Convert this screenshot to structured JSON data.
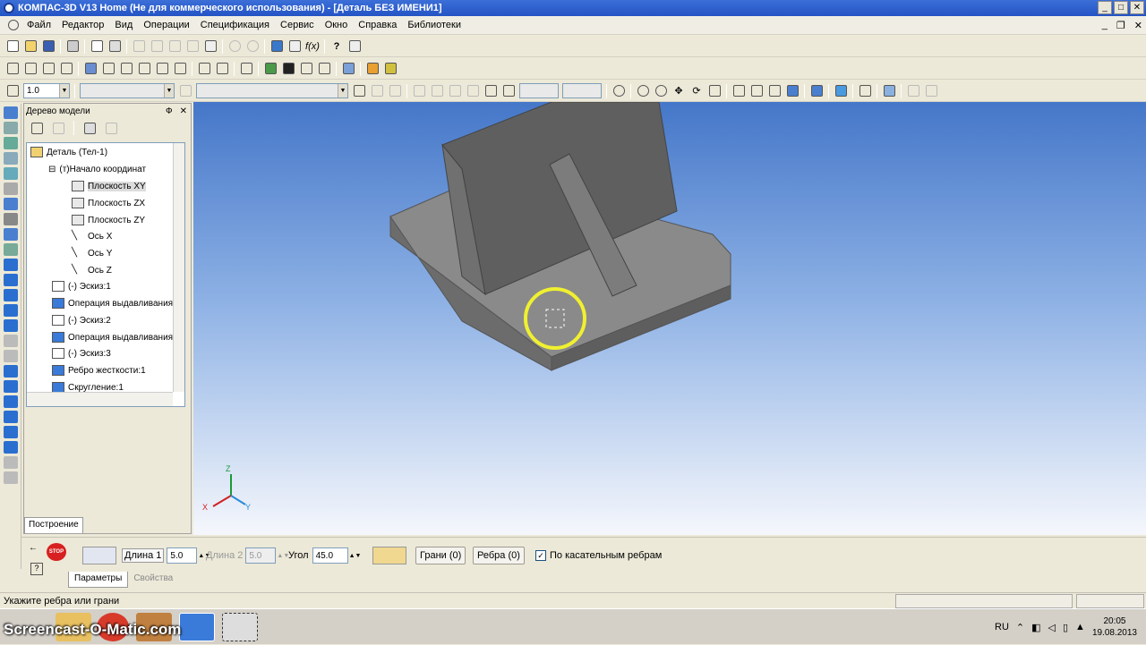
{
  "window": {
    "title": "КОМПАС-3D V13 Home (Не для коммерческого использования) - [Деталь БЕЗ ИМЕНИ1]"
  },
  "menu": {
    "items": [
      "Файл",
      "Редактор",
      "Вид",
      "Операции",
      "Спецификация",
      "Сервис",
      "Окно",
      "Справка",
      "Библиотеки"
    ]
  },
  "toolbar": {
    "scale_value": "1.0"
  },
  "tree": {
    "title": "Дерево модели",
    "pin": "Ф",
    "close": "✕",
    "nodes": [
      {
        "label": "Деталь (Тел-1)",
        "indent": 0
      },
      {
        "label": "(т)Начало координат",
        "indent": 1
      },
      {
        "label": "Плоскость XY",
        "indent": 2
      },
      {
        "label": "Плоскость ZX",
        "indent": 2
      },
      {
        "label": "Плоскость ZY",
        "indent": 2
      },
      {
        "label": "Ось X",
        "indent": 2
      },
      {
        "label": "Ось Y",
        "indent": 2
      },
      {
        "label": "Ось Z",
        "indent": 2
      },
      {
        "label": "(-) Эскиз:1",
        "indent": 1
      },
      {
        "label": "Операция выдавливания",
        "indent": 1
      },
      {
        "label": "(-) Эскиз:2",
        "indent": 1
      },
      {
        "label": "Операция выдавливания",
        "indent": 1
      },
      {
        "label": "(-) Эскиз:3",
        "indent": 1
      },
      {
        "label": "Ребро жесткости:1",
        "indent": 1
      },
      {
        "label": "Скругление:1",
        "indent": 1
      }
    ],
    "tab": "Построение"
  },
  "axes": {
    "x": "X",
    "y": "Y",
    "z": "Z"
  },
  "props": {
    "length1_label": "Длина 1",
    "length1_value": "5.0",
    "length2_label": "Длина 2",
    "length2_value": "5.0",
    "angle_label": "Угол",
    "angle_value": "45.0",
    "faces_button": "Грани (0)",
    "edges_button": "Ребра (0)",
    "tangent_label": "По касательным ребрам",
    "tab_params": "Параметры",
    "tab_props": "Свойства",
    "stop": "STOP"
  },
  "status": {
    "text": "Укажите ребра или грани"
  },
  "taskbar": {
    "lang": "RU",
    "time": "20:05",
    "date": "19.08.2013",
    "watermark": "Screencast-O-Matic.com"
  }
}
